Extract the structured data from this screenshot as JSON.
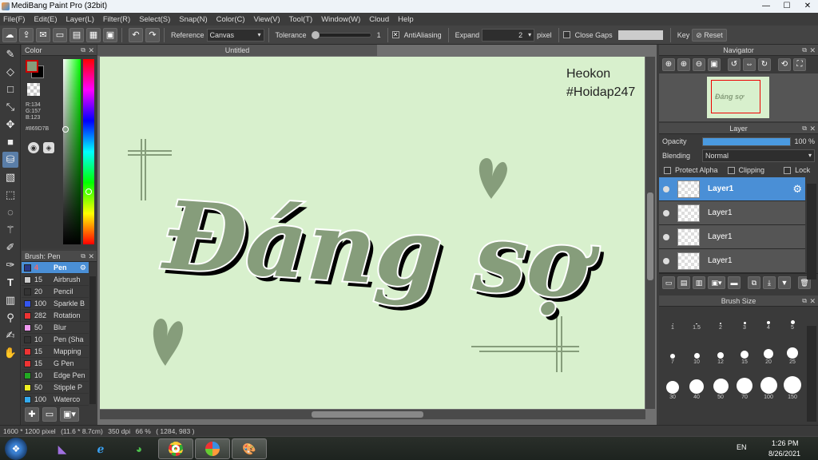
{
  "window": {
    "title": "MediBang Paint Pro (32bit)"
  },
  "menu": [
    "File(F)",
    "Edit(E)",
    "Layer(L)",
    "Filter(R)",
    "Select(S)",
    "Snap(N)",
    "Color(C)",
    "View(V)",
    "Tool(T)",
    "Window(W)",
    "Cloud",
    "Help"
  ],
  "toolbar": {
    "reference_label": "Reference",
    "reference_value": "Canvas",
    "tolerance_label": "Tolerance",
    "tolerance_value": "1",
    "tolerance_fraction": 0.03,
    "antialiasing_label": "AntiAliasing",
    "antialiasing_checked": true,
    "expand_label": "Expand",
    "expand_value": "2",
    "expand_unit": "pixel",
    "close_gaps_label": "Close Gaps",
    "close_gaps_checked": false,
    "key_label": "Key",
    "reset_label": "Reset"
  },
  "color_panel": {
    "title": "Color",
    "r_text": "R:134",
    "g_text": "G:157",
    "b_text": "B:123",
    "hex_text": "#869D7B",
    "current_color": "#869D7B"
  },
  "brush_panel": {
    "title": "Brush: Pen",
    "brushes": [
      {
        "size": "4",
        "name": "Pen",
        "color": "#2a3a8a",
        "selected": true
      },
      {
        "size": "15",
        "name": "Airbrush",
        "color": "#cccccc"
      },
      {
        "size": "20",
        "name": "Pencil",
        "color": "#333333"
      },
      {
        "size": "100",
        "name": "Sparkle B",
        "color": "#3355ee"
      },
      {
        "size": "282",
        "name": "Rotation",
        "color": "#ee3333"
      },
      {
        "size": "50",
        "name": "Blur",
        "color": "#ee99ee"
      },
      {
        "size": "10",
        "name": "Pen (Sha",
        "color": "#333333"
      },
      {
        "size": "15",
        "name": "Mapping",
        "color": "#ee3333"
      },
      {
        "size": "15",
        "name": "G Pen",
        "color": "#ee3333"
      },
      {
        "size": "10",
        "name": "Edge Pen",
        "color": "#22aa22"
      },
      {
        "size": "50",
        "name": "Stipple P",
        "color": "#eeee22"
      },
      {
        "size": "100",
        "name": "Waterco",
        "color": "#33aaee"
      }
    ]
  },
  "document": {
    "tab_title": "Untitled",
    "credit_line1": "Heokon",
    "credit_line2": "#Hoidap247",
    "artwork_text": "Đáng sợ",
    "bg_color": "#d8f0cd",
    "ink_color": "#869D7B"
  },
  "navigator": {
    "title": "Navigator"
  },
  "layer_panel": {
    "title": "Layer",
    "opacity_label": "Opacity",
    "opacity_value": "100 %",
    "opacity_fraction": 1.0,
    "blending_label": "Blending",
    "blending_value": "Normal",
    "protect_alpha_label": "Protect Alpha",
    "clipping_label": "Clipping",
    "lock_label": "Lock",
    "layers": [
      {
        "name": "Layer1",
        "selected": true
      },
      {
        "name": "Layer1",
        "selected": false
      },
      {
        "name": "Layer1",
        "selected": false
      },
      {
        "name": "Layer1",
        "selected": false
      }
    ]
  },
  "brush_size_panel": {
    "title": "Brush Size",
    "sizes": [
      "1",
      "1.5",
      "2",
      "3",
      "4",
      "5",
      "7",
      "10",
      "12",
      "15",
      "20",
      "25",
      "30",
      "40",
      "50",
      "70",
      "100",
      "150"
    ]
  },
  "status": {
    "size_text": "1600 * 1200 pixel",
    "physical_text": "(11.6 * 8.7cm)",
    "dpi_text": "350 dpi",
    "zoom_text": "66 %",
    "coord_text": "( 1284, 983 )"
  },
  "taskbar": {
    "lang": "EN",
    "time": "1:26 PM",
    "date": "8/26/2021"
  }
}
